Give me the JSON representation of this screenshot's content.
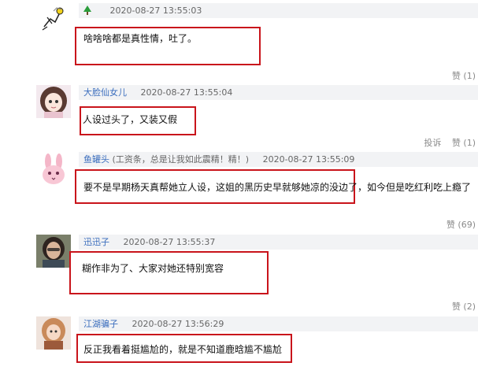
{
  "comments": [
    {
      "user": "",
      "note": "",
      "time": "2020-08-27 13:55:03",
      "text": "啥啥啥都是真性情，吐了。",
      "like_label": "赞",
      "like_count": "(1)",
      "report_label": ""
    },
    {
      "user": "大脸仙女儿",
      "note": "",
      "time": "2020-08-27 13:55:04",
      "text": "人设过头了，又装又假",
      "like_label": "",
      "like_count": "",
      "report_label": "投诉",
      "report_like_label": "赞",
      "report_like_count": "(1)"
    },
    {
      "user": "鱼罐头",
      "note": "(工资条，总是让我如此震精！精！)",
      "time": "2020-08-27 13:55:09",
      "text": "要不是早期杨天真帮她立人设，这姐的黑历史早就够她凉的没边了，如今但是吃红利吃上瘾了",
      "like_label": "赞",
      "like_count": "(69)"
    },
    {
      "user": "迅迅子",
      "note": "",
      "time": "2020-08-27 13:55:37",
      "text": "糊作非为了、大家对她还特别宽容",
      "like_label": "赞",
      "like_count": "(2)"
    },
    {
      "user": "江湖骗子",
      "note": "",
      "time": "2020-08-27 13:56:29",
      "text": "反正我看着挺尴尬的，就是不知道鹿晗尴不尴尬",
      "like_label": "",
      "like_count": ""
    }
  ],
  "icons": {
    "c0_avatar": "doodle-figure-avatar",
    "c0_badge": "green-tree-icon",
    "c1_avatar": "anime-girl-avatar",
    "c2_avatar": "pink-bunny-avatar",
    "c3_avatar": "woman-photo-avatar",
    "c4_avatar": "doll-photo-avatar"
  },
  "colors": {
    "highlight_box": "#c9141b",
    "username": "#3a6dbd",
    "header_bg": "#f2f3f5",
    "meta_text": "#8a8a8a"
  }
}
